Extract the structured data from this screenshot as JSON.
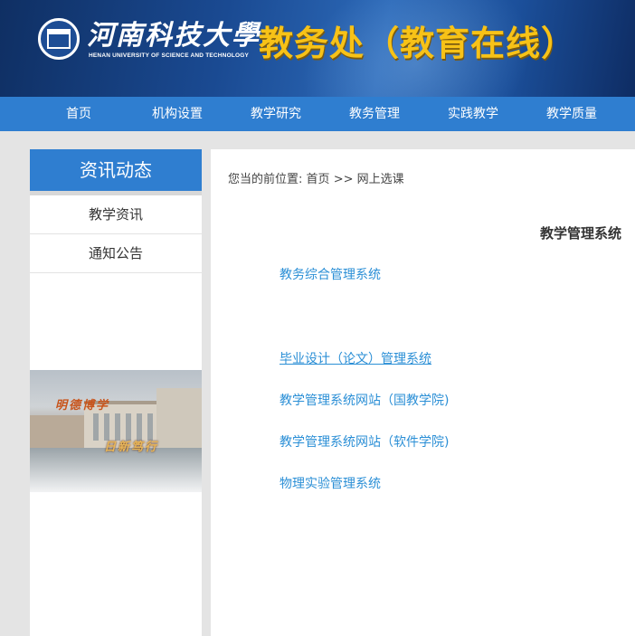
{
  "header": {
    "university_cn": "河南科技大學",
    "university_en": "HENAN UNIVERSITY OF SCIENCE AND TECHNOLOGY",
    "site_title": "教务处（教育在线）"
  },
  "nav": {
    "items": [
      {
        "label": "首页"
      },
      {
        "label": "机构设置"
      },
      {
        "label": "教学研究"
      },
      {
        "label": "教务管理"
      },
      {
        "label": "实践教学"
      },
      {
        "label": "教学质量"
      }
    ]
  },
  "sidebar": {
    "title": "资讯动态",
    "items": [
      {
        "label": "教学资讯"
      },
      {
        "label": "通知公告"
      }
    ],
    "banner": {
      "line1": "明德博学",
      "line2": "日新笃行"
    }
  },
  "main": {
    "breadcrumb": {
      "prefix": "您当的前位置:",
      "home": "首页",
      "separator": ">>",
      "current": "网上选课"
    },
    "section_title": "教学管理系统",
    "links": [
      {
        "label": "教务综合管理系统"
      },
      {
        "label": "毕业设计（论文）管理系统"
      },
      {
        "label": "教学管理系统网站（国教学院)"
      },
      {
        "label": "教学管理系统网站（软件学院)"
      },
      {
        "label": "物理实验管理系统"
      }
    ]
  },
  "colors": {
    "nav_blue": "#2f7ed0",
    "link_blue": "#2b8fd6",
    "title_gold": "#f7c217",
    "header_navy": "#0f2f63"
  }
}
